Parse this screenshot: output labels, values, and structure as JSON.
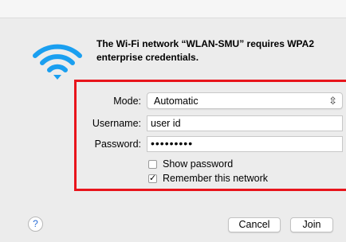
{
  "dialog": {
    "message": "The Wi-Fi network “WLAN-SMU” requires WPA2 enterprise credentials."
  },
  "form": {
    "mode_label": "Mode:",
    "mode_value": "Automatic",
    "username_label": "Username:",
    "username_value": "user id",
    "password_label": "Password:",
    "password_value": "•••••••••",
    "show_password_label": "Show password",
    "show_password_checked": false,
    "remember_label": "Remember this network",
    "remember_checked": true
  },
  "buttons": {
    "help": "?",
    "cancel": "Cancel",
    "join": "Join"
  },
  "colors": {
    "highlight": "#e8141b",
    "wifi": "#1a9ff0"
  },
  "icons": {
    "wifi": "wifi-icon",
    "select_arrows": "chevron-updown-icon",
    "check": "checkmark-icon"
  }
}
